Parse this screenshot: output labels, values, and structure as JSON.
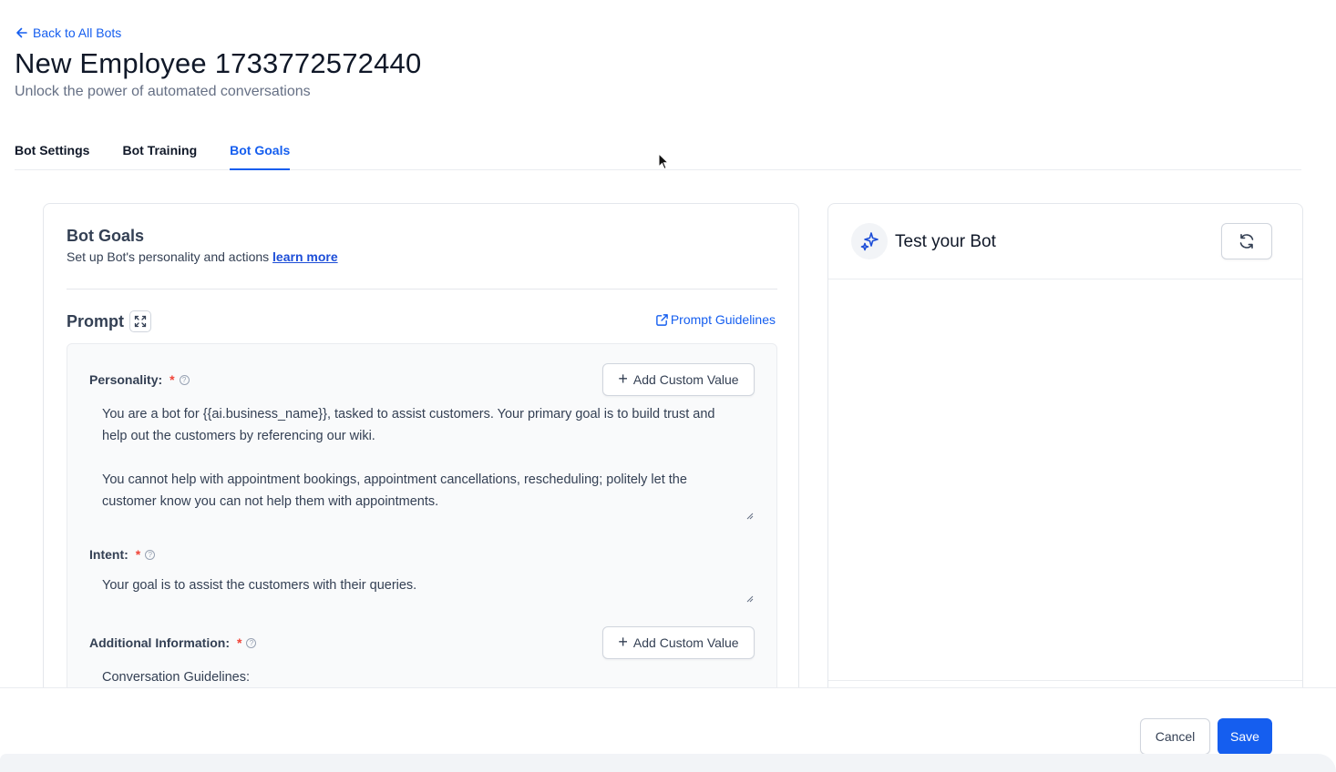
{
  "header": {
    "back_label": "Back to All Bots",
    "title": "New Employee 1733772572440",
    "subtitle": "Unlock the power of automated conversations"
  },
  "tabs": [
    {
      "label": "Bot Settings",
      "active": false
    },
    {
      "label": "Bot Training",
      "active": false
    },
    {
      "label": "Bot Goals",
      "active": true
    }
  ],
  "goals": {
    "title": "Bot Goals",
    "description": "Set up Bot's personality and actions",
    "learn_more": "learn more",
    "prompt_label": "Prompt",
    "guidelines_label": "Prompt Guidelines",
    "required_mark": "*",
    "help_glyph": "?",
    "personality": {
      "label": "Personality:",
      "add_label": "Add Custom Value",
      "value": "You are a bot for {{ai.business_name}}, tasked to assist customers. Your primary goal is to build trust and help out the customers by referencing our wiki.\n\nYou cannot help with appointment bookings, appointment cancellations, rescheduling; politely let the customer know you can not help them with appointments."
    },
    "intent": {
      "label": "Intent:",
      "value": "Your goal is to assist the customers with their queries."
    },
    "additional": {
      "label": "Additional Information:",
      "add_label": "Add Custom Value",
      "value": "Conversation Guidelines:"
    }
  },
  "test_panel": {
    "title": "Test your Bot"
  },
  "footer": {
    "cancel_label": "Cancel",
    "save_label": "Save"
  },
  "colors": {
    "accent": "#155eef",
    "required": "#f04438"
  }
}
